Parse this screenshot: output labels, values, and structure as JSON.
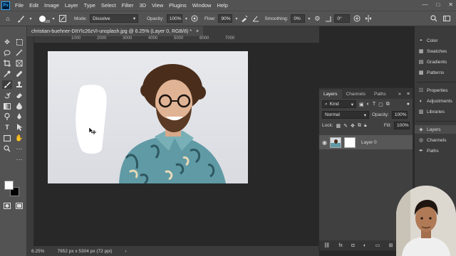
{
  "menu": {
    "items": [
      "File",
      "Edit",
      "Image",
      "Layer",
      "Type",
      "Select",
      "Filter",
      "3D",
      "View",
      "Plugins",
      "Window",
      "Help"
    ],
    "logo": "Ps"
  },
  "window_controls": {
    "minimize": "—",
    "maximize": "□",
    "close": "✕"
  },
  "options": {
    "brush_size": "500",
    "mode_label": "Mode:",
    "mode_value": "Dissolve",
    "opacity_label": "Opacity:",
    "opacity_value": "100%",
    "flow_label": "Flow:",
    "flow_value": "90%",
    "smoothing_label": "Smoothing:",
    "smoothing_value": "0%",
    "angle_value": "0°"
  },
  "document": {
    "tab_title": "christian-buehner-DItYlc26zVI-unsplash.jpg @ 6.25% (Layer 0, RGB/8) *",
    "close": "×",
    "ruler_ticks": [
      "1000",
      "2000",
      "3000",
      "4000",
      "5000",
      "6000",
      "7000"
    ]
  },
  "status": {
    "zoom": "6.25%",
    "dimensions": "7952 px x 5304 px (72 ppi)"
  },
  "layers_panel": {
    "tabs": [
      "Layers",
      "Channels",
      "Paths"
    ],
    "filter_kind": "Kind",
    "blend_mode": "Normal",
    "opacity_label": "Opacity:",
    "opacity_value": "100%",
    "lock_label": "Lock:",
    "fill_label": "Fill:",
    "fill_value": "100%",
    "layer_name": "Layer 0",
    "bottom_icons": [
      "fx"
    ]
  },
  "dock": {
    "items": [
      "Color",
      "Swatches",
      "Gradients",
      "Patterns",
      "Properties",
      "Adjustments",
      "Libraries",
      "Layers",
      "Channels",
      "Paths"
    ]
  },
  "colors": {
    "chrome": "#535353",
    "panel": "#404040",
    "canvas_bg": "#282828",
    "accent": "#31a8ff"
  },
  "icons": {
    "toolbar": [
      "move-icon",
      "marquee-icon",
      "lasso-icon",
      "magic-wand-icon",
      "crop-icon",
      "frame-icon",
      "eyedropper-icon",
      "healing-icon",
      "brush-icon",
      "stamp-icon",
      "history-brush-icon",
      "eraser-icon",
      "gradient-icon",
      "blur-icon",
      "dodge-icon",
      "pen-icon",
      "type-icon",
      "path-select-icon",
      "rectangle-icon",
      "hand-icon",
      "zoom-icon",
      "more-icon"
    ]
  }
}
